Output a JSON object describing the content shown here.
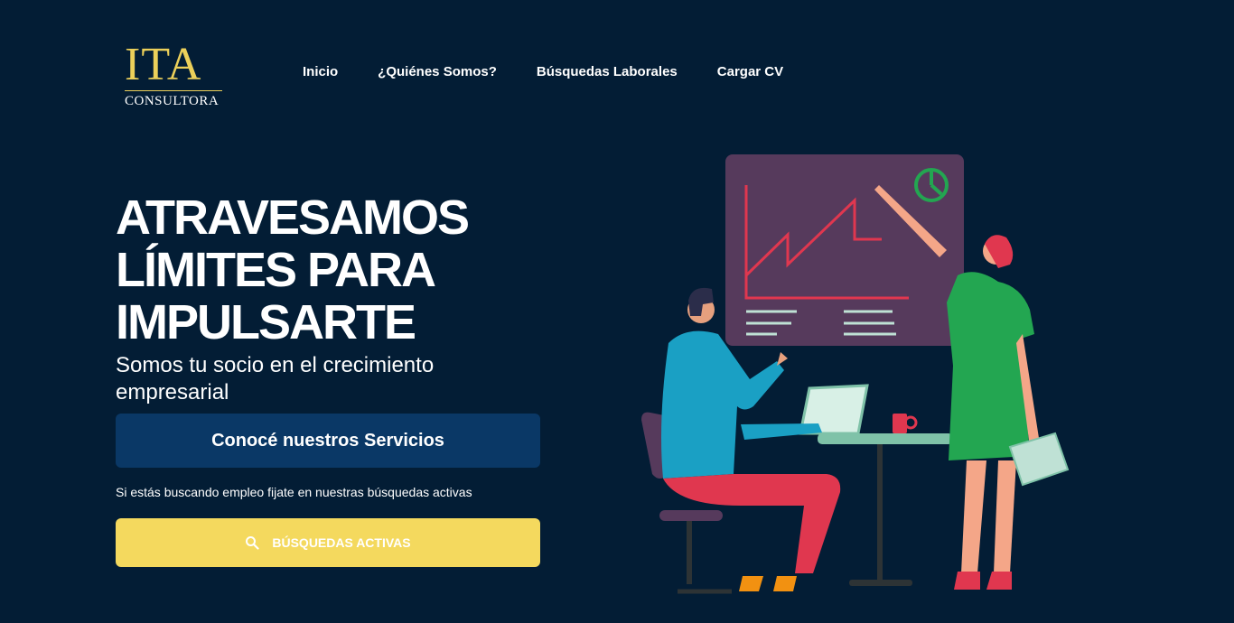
{
  "logo": {
    "main": "ITA",
    "sub": "CONSULTORA"
  },
  "nav": {
    "items": [
      {
        "label": "Inicio"
      },
      {
        "label": "¿Quiénes Somos?"
      },
      {
        "label": "Búsquedas Laborales"
      },
      {
        "label": "Cargar CV"
      }
    ]
  },
  "hero": {
    "title_lines": [
      "ATRAVESAMOS",
      "LÍMITES PARA",
      "IMPULSARTE"
    ],
    "subtitle": "Somos tu socio en el crecimiento empresarial",
    "services_button": "Conocé nuestros Servicios",
    "hint": "Si estás buscando empleo fijate en nuestras búsquedas activas",
    "active_button": "BÚSQUEDAS ACTIVAS",
    "active_button_icon": "search-icon"
  },
  "colors": {
    "background": "#031d35",
    "accent_yellow": "#f4d95e",
    "button_blue": "#0a3866",
    "logo_gold": "#ecd05a"
  },
  "illustration": {
    "description_icon": "office-team-illustration"
  }
}
